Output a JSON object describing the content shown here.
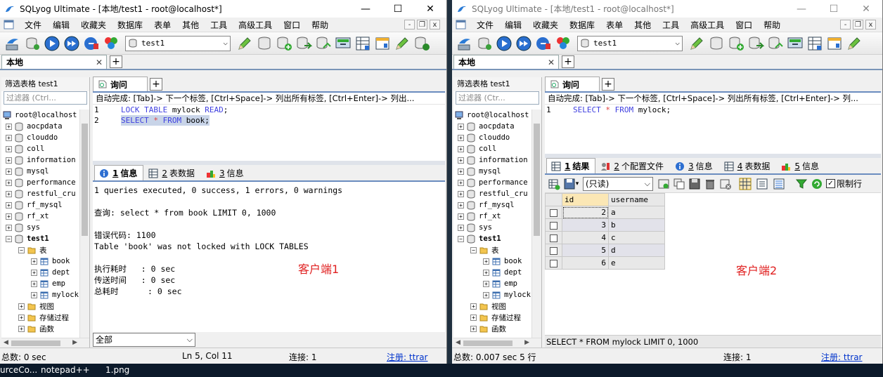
{
  "windows": [
    {
      "id": "client1",
      "title": "SQLyog Ultimate - [本地/test1 - root@localhost*]",
      "title_active": true,
      "menu": [
        "文件",
        "编辑",
        "收藏夹",
        "数据库",
        "表单",
        "其他",
        "工具",
        "高级工具",
        "窗口",
        "帮助"
      ],
      "db_select": "test1",
      "conn_tab": "本地",
      "filter_label": "筛选表格 test1",
      "filter_placeholder": "过滤器 (Ctrl...",
      "tree": [
        {
          "label": "root@localhost",
          "level": 0,
          "icon": "server",
          "exp": ""
        },
        {
          "label": "aocpdata",
          "level": 1,
          "icon": "db",
          "exp": "+"
        },
        {
          "label": "clouddo",
          "level": 1,
          "icon": "db",
          "exp": "+"
        },
        {
          "label": "coll",
          "level": 1,
          "icon": "db",
          "exp": "+"
        },
        {
          "label": "information",
          "level": 1,
          "icon": "db",
          "exp": "+"
        },
        {
          "label": "mysql",
          "level": 1,
          "icon": "db",
          "exp": "+"
        },
        {
          "label": "performance",
          "level": 1,
          "icon": "db",
          "exp": "+"
        },
        {
          "label": "restful_cru",
          "level": 1,
          "icon": "db",
          "exp": "+"
        },
        {
          "label": "rf_mysql",
          "level": 1,
          "icon": "db",
          "exp": "+"
        },
        {
          "label": "rf_xt",
          "level": 1,
          "icon": "db",
          "exp": "+"
        },
        {
          "label": "sys",
          "level": 1,
          "icon": "db",
          "exp": "+"
        },
        {
          "label": "test1",
          "level": 1,
          "icon": "db",
          "exp": "-",
          "bold": true
        },
        {
          "label": "表",
          "level": 2,
          "icon": "folder",
          "exp": "-"
        },
        {
          "label": "book",
          "level": 3,
          "icon": "table",
          "exp": "+"
        },
        {
          "label": "dept",
          "level": 3,
          "icon": "table",
          "exp": "+"
        },
        {
          "label": "emp",
          "level": 3,
          "icon": "table",
          "exp": "+"
        },
        {
          "label": "mylock",
          "level": 3,
          "icon": "table",
          "exp": "+"
        },
        {
          "label": "视图",
          "level": 2,
          "icon": "folder",
          "exp": "+"
        },
        {
          "label": "存储过程",
          "level": 2,
          "icon": "folder",
          "exp": "+"
        },
        {
          "label": "函数",
          "level": 2,
          "icon": "folder",
          "exp": "+"
        }
      ],
      "query_tab": "询问",
      "autocomplete": "自动完成: [Tab]-> 下一个标签, [Ctrl+Space]-> 列出所有标签, [Ctrl+Enter]-> 列出...",
      "code": [
        {
          "n": "1",
          "parts": [
            {
              "t": "LOCK TABLE",
              "c": "kw"
            },
            {
              "t": " mylock ",
              "c": ""
            },
            {
              "t": "READ",
              "c": "kw"
            },
            {
              "t": ";",
              "c": ""
            }
          ],
          "selected": false
        },
        {
          "n": "2",
          "parts": [
            {
              "t": "SELECT",
              "c": "kw"
            },
            {
              "t": " ",
              "c": ""
            },
            {
              "t": "*",
              "c": "op"
            },
            {
              "t": " ",
              "c": ""
            },
            {
              "t": "FROM",
              "c": "kw"
            },
            {
              "t": " book;",
              "c": ""
            }
          ],
          "selected": true
        }
      ],
      "result_tabs": [
        {
          "n": "1",
          "label": "信息",
          "icon": "info",
          "active": true
        },
        {
          "n": "2",
          "label": "表数据",
          "icon": "grid",
          "active": false
        },
        {
          "n": "3",
          "label": "信息",
          "icon": "blocks",
          "active": false
        }
      ],
      "messages": [
        "1 queries executed, 0 success, 1 errors, 0 warnings",
        "",
        "查询: select * from book LIMIT 0, 1000",
        "",
        "错误代码: 1100",
        "Table 'book' was not locked with LOCK TABLES",
        "",
        "执行耗时   : 0 sec",
        "传送时间   : 0 sec",
        "总耗时      : 0 sec"
      ],
      "filter_combo": "全部",
      "client_label": "客户端1",
      "status": {
        "total": "总数: 0 sec",
        "pos": "Ln 5, Col 11",
        "conn": "连接: 1",
        "reg": "注册: ttrar"
      }
    },
    {
      "id": "client2",
      "title": "SQLyog Ultimate - [本地/test1 - root@localhost*]",
      "title_active": false,
      "menu": [
        "文件",
        "编辑",
        "收藏夹",
        "数据库",
        "表单",
        "其他",
        "工具",
        "高级工具",
        "窗口",
        "帮助"
      ],
      "db_select": "test1",
      "conn_tab": "本地",
      "filter_label": "筛选表格 test1",
      "filter_placeholder": "过滤器 (Ctr...",
      "tree": [
        {
          "label": "root@localhost",
          "level": 0,
          "icon": "server",
          "exp": ""
        },
        {
          "label": "aocpdata",
          "level": 1,
          "icon": "db",
          "exp": "+"
        },
        {
          "label": "clouddo",
          "level": 1,
          "icon": "db",
          "exp": "+"
        },
        {
          "label": "coll",
          "level": 1,
          "icon": "db",
          "exp": "+"
        },
        {
          "label": "information",
          "level": 1,
          "icon": "db",
          "exp": "+"
        },
        {
          "label": "mysql",
          "level": 1,
          "icon": "db",
          "exp": "+"
        },
        {
          "label": "performance",
          "level": 1,
          "icon": "db",
          "exp": "+"
        },
        {
          "label": "restful_cru",
          "level": 1,
          "icon": "db",
          "exp": "+"
        },
        {
          "label": "rf_mysql",
          "level": 1,
          "icon": "db",
          "exp": "+"
        },
        {
          "label": "rf_xt",
          "level": 1,
          "icon": "db",
          "exp": "+"
        },
        {
          "label": "sys",
          "level": 1,
          "icon": "db",
          "exp": "+"
        },
        {
          "label": "test1",
          "level": 1,
          "icon": "db",
          "exp": "-",
          "bold": true
        },
        {
          "label": "表",
          "level": 2,
          "icon": "folder",
          "exp": "-"
        },
        {
          "label": "book",
          "level": 3,
          "icon": "table",
          "exp": "+"
        },
        {
          "label": "dept",
          "level": 3,
          "icon": "table",
          "exp": "+"
        },
        {
          "label": "emp",
          "level": 3,
          "icon": "table",
          "exp": "+"
        },
        {
          "label": "mylock",
          "level": 3,
          "icon": "table",
          "exp": "+"
        },
        {
          "label": "视图",
          "level": 2,
          "icon": "folder",
          "exp": "+"
        },
        {
          "label": "存储过程",
          "level": 2,
          "icon": "folder",
          "exp": "+"
        },
        {
          "label": "函数",
          "level": 2,
          "icon": "folder",
          "exp": "+"
        }
      ],
      "query_tab": "询问",
      "autocomplete": "自动完成: [Tab]-> 下一个标签, [Ctrl+Space]-> 列出所有标签, [Ctrl+Enter]-> 列...",
      "code": [
        {
          "n": "1",
          "parts": [
            {
              "t": "SELECT",
              "c": "kw"
            },
            {
              "t": " ",
              "c": ""
            },
            {
              "t": "*",
              "c": "op"
            },
            {
              "t": " ",
              "c": ""
            },
            {
              "t": "FROM",
              "c": "kw"
            },
            {
              "t": " mylock;",
              "c": ""
            }
          ],
          "selected": false
        }
      ],
      "result_tabs": [
        {
          "n": "1",
          "label": "结果",
          "icon": "grid",
          "active": true
        },
        {
          "n": "2",
          "label": "个配置文件",
          "icon": "profile",
          "active": false
        },
        {
          "n": "3",
          "label": "信息",
          "icon": "info",
          "active": false
        },
        {
          "n": "4",
          "label": "表数据",
          "icon": "grid",
          "active": false
        },
        {
          "n": "5",
          "label": "信息",
          "icon": "blocks",
          "active": false
        }
      ],
      "readonly": "(只读)",
      "limit_label": "限制行",
      "grid": {
        "columns": [
          "id",
          "username"
        ],
        "rows": [
          [
            "2",
            "a"
          ],
          [
            "3",
            "b"
          ],
          [
            "4",
            "c"
          ],
          [
            "5",
            "d"
          ],
          [
            "6",
            "e"
          ]
        ]
      },
      "sql_status": "SELECT * FROM mylock LIMIT 0, 1000",
      "client_label": "客户端2",
      "status": {
        "total": "总数: 0.007 sec  5 行",
        "conn": "连接: 1",
        "reg": "注册: ttrar"
      }
    }
  ],
  "taskbar": [
    "urceCo...",
    "notepad++",
    "1.png"
  ],
  "colors": {
    "keyword": "#4040e0",
    "operator": "#e04040",
    "client_label": "#e02020",
    "link": "#0033cc",
    "tab_border": "#6a8cbf"
  }
}
